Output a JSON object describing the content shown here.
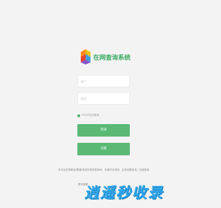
{
  "app": {
    "title": "在网查询系统"
  },
  "login_form": {
    "username_placeholder": "账户",
    "password_placeholder": "密码",
    "remember_label": "30天内自动登录",
    "remember_checked": true,
    "login_label": "登录",
    "register_label": "注册"
  },
  "footer": {
    "notice": "本平台支持移动/联通/电信在网状态查询、在网时长查询、业务余额查询、充值查询",
    "contact": "联系客服"
  },
  "watermark": {
    "text": "逍遥秒收录"
  },
  "colors": {
    "background": "#f3f3f3",
    "accent_green": "#5bb975",
    "title_green": "#3eab63",
    "watermark_blue": "#2ea5ea"
  }
}
